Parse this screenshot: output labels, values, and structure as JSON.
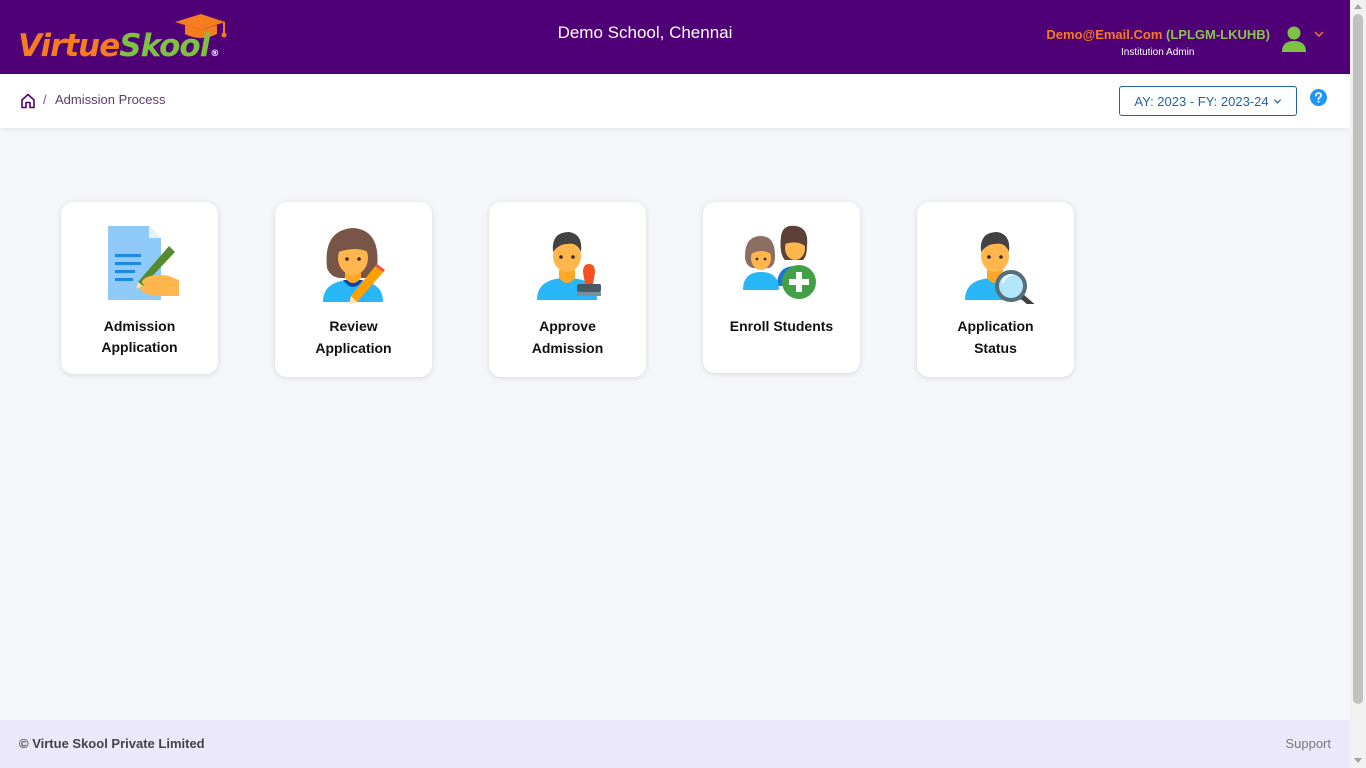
{
  "brand": {
    "logo_part1": "Virtue",
    "logo_part2": "Skool",
    "logo_reg": "®"
  },
  "header": {
    "school": "Demo School, Chennai",
    "user_email": "Demo@Email.Com",
    "user_code": "(LPLGM-LKUHB)",
    "user_role": "Institution Admin"
  },
  "breadcrumb": {
    "separator": "/",
    "current": "Admission Process"
  },
  "year_selector": {
    "label": "AY: 2023 - FY: 2023-24"
  },
  "cards": [
    {
      "line1": "Admission",
      "line2": "Application",
      "icon": "document-pen-icon"
    },
    {
      "line1": "Review",
      "line2": "Application",
      "icon": "woman-pencil-icon"
    },
    {
      "line1": "Approve",
      "line2": "Admission",
      "icon": "man-stamp-icon"
    },
    {
      "line1": "Enroll Students",
      "line2": "",
      "icon": "group-add-icon"
    },
    {
      "line1": "Application",
      "line2": "Status",
      "icon": "man-magnifier-icon"
    }
  ],
  "footer": {
    "copyright": "© Virtue Skool Private Limited",
    "support": "Support"
  },
  "colors": {
    "header_bg": "#500077",
    "brand_orange": "#f57c1f",
    "brand_green": "#7dc242",
    "footer_bg": "#ece8fb",
    "accent_blue": "#1f64a8"
  }
}
